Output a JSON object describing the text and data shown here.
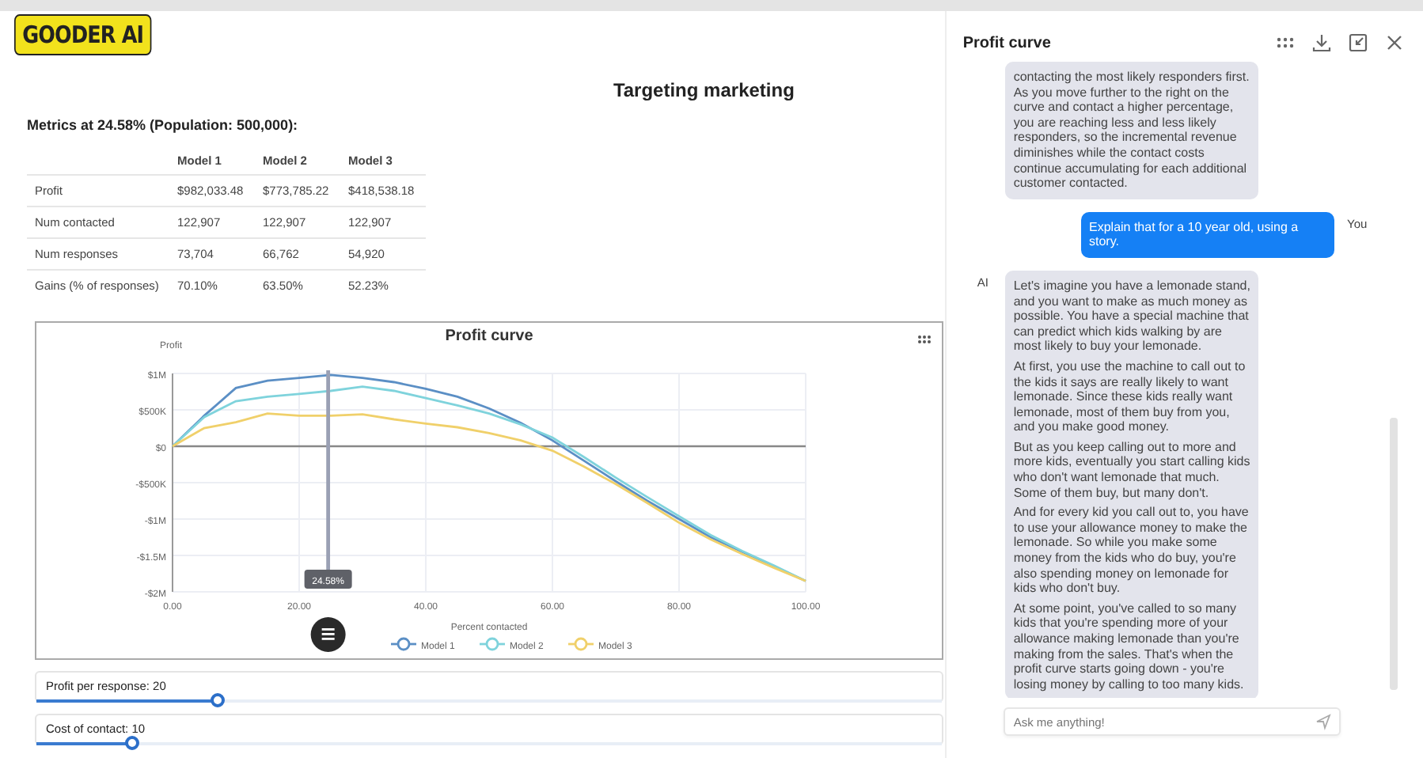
{
  "logo": "GOODER AI",
  "page_title": "Targeting marketing",
  "metrics_heading": "Metrics at 24.58% (Population: 500,000):",
  "table": {
    "columns": [
      "Model 1",
      "Model 2",
      "Model 3"
    ],
    "rows": [
      {
        "label": "Profit",
        "values": [
          "$982,033.48",
          "$773,785.22",
          "$418,538.18"
        ]
      },
      {
        "label": "Num contacted",
        "values": [
          "122,907",
          "122,907",
          "122,907"
        ]
      },
      {
        "label": "Num responses",
        "values": [
          "73,704",
          "66,762",
          "54,920"
        ]
      },
      {
        "label": "Gains (% of responses)",
        "values": [
          "70.10%",
          "63.50%",
          "52.23%"
        ]
      }
    ]
  },
  "chart_data": {
    "type": "line",
    "title": "Profit curve",
    "xlabel": "Percent contacted",
    "ylabel": "Profit",
    "x": [
      0,
      5,
      10,
      15,
      20,
      25,
      30,
      35,
      40,
      45,
      50,
      55,
      60,
      65,
      70,
      75,
      80,
      85,
      90,
      95,
      100
    ],
    "series": [
      {
        "name": "Model 1",
        "color": "#5b8fc5",
        "values": [
          0,
          420000,
          800000,
          900000,
          940000,
          980000,
          940000,
          880000,
          790000,
          680000,
          520000,
          320000,
          80000,
          -200000,
          -480000,
          -750000,
          -1000000,
          -1250000,
          -1450000,
          -1650000,
          -1850000
        ]
      },
      {
        "name": "Model 2",
        "color": "#7fd3dc",
        "values": [
          0,
          400000,
          620000,
          680000,
          720000,
          760000,
          820000,
          760000,
          660000,
          560000,
          450000,
          300000,
          120000,
          -150000,
          -430000,
          -700000,
          -960000,
          -1220000,
          -1440000,
          -1640000,
          -1850000
        ]
      },
      {
        "name": "Model 3",
        "color": "#f0d06a",
        "values": [
          0,
          250000,
          330000,
          450000,
          420000,
          420000,
          440000,
          370000,
          310000,
          260000,
          180000,
          80000,
          -60000,
          -280000,
          -520000,
          -780000,
          -1050000,
          -1280000,
          -1480000,
          -1670000,
          -1850000
        ]
      }
    ],
    "xlim": [
      0,
      100
    ],
    "ylim": [
      -2000000,
      1000000
    ],
    "xticks": [
      {
        "value": 0,
        "label": "0.00"
      },
      {
        "value": 20,
        "label": "20.00"
      },
      {
        "value": 40,
        "label": "40.00"
      },
      {
        "value": 60,
        "label": "60.00"
      },
      {
        "value": 80,
        "label": "80.00"
      },
      {
        "value": 100,
        "label": "100.00"
      }
    ],
    "yticks": [
      {
        "value": 1000000,
        "label": "$1M"
      },
      {
        "value": 500000,
        "label": "$500K"
      },
      {
        "value": 0,
        "label": "$0"
      },
      {
        "value": -500000,
        "label": "-$500K"
      },
      {
        "value": -1000000,
        "label": "-$1M"
      },
      {
        "value": -1500000,
        "label": "-$1.5M"
      },
      {
        "value": -2000000,
        "label": "-$2M"
      }
    ],
    "grid": true,
    "legend": true,
    "ref_lines": [
      {
        "axis": "x",
        "value": 24.58
      }
    ],
    "annotations": [
      {
        "x": 24.58,
        "text": "24.58%"
      }
    ]
  },
  "sliders": [
    {
      "label": "Profit per response: 20",
      "level": 0.2
    },
    {
      "label": "Cost of contact: 10",
      "level": 0.105
    }
  ],
  "chat": {
    "title": "Profit curve",
    "messages": [
      {
        "kind": "ai",
        "paragraphs": [
          "contacting the most likely responders first. As you move further to the right on the curve and contact a higher percentage, you are reaching less and less likely responders, so the incremental revenue diminishes while the contact costs continue accumulating for each additional customer contacted."
        ]
      },
      {
        "kind": "user",
        "sender": "You",
        "paragraphs": [
          "Explain that for a 10 year old, using a story."
        ]
      },
      {
        "kind": "ai",
        "sender": "AI",
        "paragraphs": [
          "Let's imagine you have a lemonade stand, and you want to make as much money as possible. You have a special machine that can predict which kids walking by are most likely to buy your lemonade.",
          "At first, you use the machine to call out to the kids it says are really likely to want lemonade. Since these kids really want lemonade, most of them buy from you, and you make good money.",
          "But as you keep calling out to more and more kids, eventually you start calling kids who don't want lemonade that much. Some of them buy, but many don't.",
          "And for every kid you call out to, you have to use your allowance money to make the lemonade. So while you make some money from the kids who do buy, you're also spending money on lemonade for kids who don't buy.",
          "At some point, you've called to so many kids that you're spending more of your allowance making lemonade than you're making from the sales. That's when the profit curve starts going down - you're losing money by calling to too many kids."
        ]
      }
    ],
    "input": {
      "placeholder": "Ask me anything!"
    }
  }
}
